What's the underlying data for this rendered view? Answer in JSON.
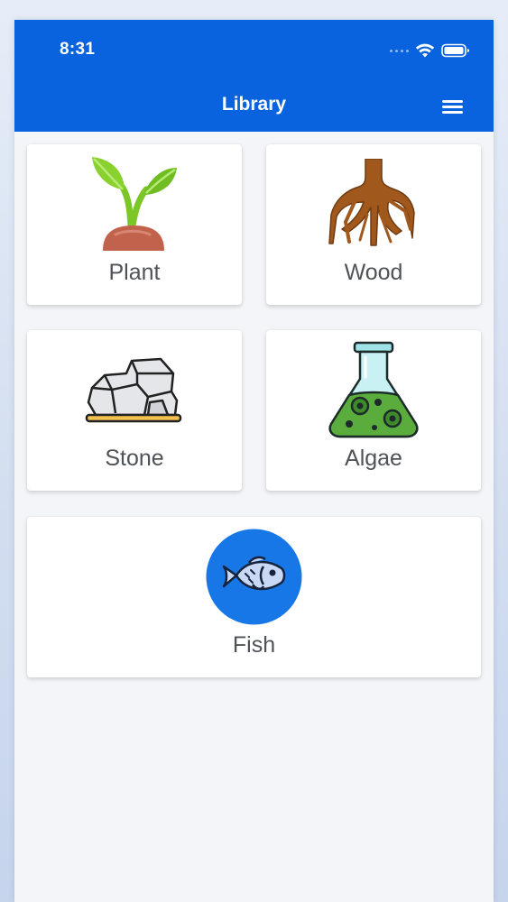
{
  "status_bar": {
    "time": "8:31",
    "icons": [
      "cellular-icon",
      "wifi-icon",
      "battery-icon"
    ]
  },
  "header": {
    "title": "Library",
    "menu_icon": "hamburger-menu-icon"
  },
  "colors": {
    "header_bg": "#0a63de",
    "card_bg": "#ffffff",
    "label_text": "#4f5357",
    "fish_circle": "#1777e6"
  },
  "categories": [
    {
      "label": "Plant",
      "icon": "plant-icon"
    },
    {
      "label": "Wood",
      "icon": "wood-root-icon"
    },
    {
      "label": "Stone",
      "icon": "stone-icon"
    },
    {
      "label": "Algae",
      "icon": "algae-flask-icon"
    },
    {
      "label": "Fish",
      "icon": "fish-icon"
    }
  ]
}
